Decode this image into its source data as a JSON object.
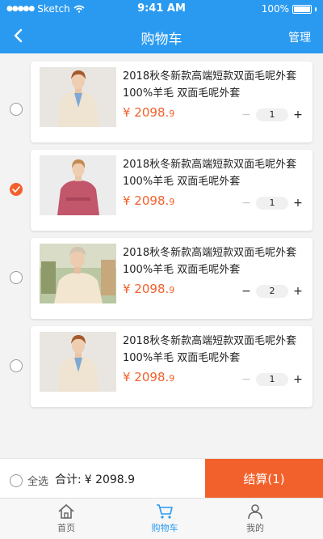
{
  "status": {
    "carrier": "Sketch",
    "time": "9:41 AM",
    "battery": "100%"
  },
  "nav": {
    "title": "购物车",
    "manage": "管理"
  },
  "items": [
    {
      "title": "2018秋冬新款高端短款双面毛呢外套100%羊毛 双面毛呢外套",
      "price_main": "¥ 2098.",
      "price_dec": "9",
      "qty": "1",
      "checked": false
    },
    {
      "title": "2018秋冬新款高端短款双面毛呢外套100%羊毛 双面毛呢外套",
      "price_main": "¥ 2098.",
      "price_dec": "9",
      "qty": "1",
      "checked": true
    },
    {
      "title": "2018秋冬新款高端短款双面毛呢外套100%羊毛 双面毛呢外套",
      "price_main": "¥ 2098.",
      "price_dec": "9",
      "qty": "2",
      "checked": false
    },
    {
      "title": "2018秋冬新款高端短款双面毛呢外套100%羊毛 双面毛呢外套",
      "price_main": "¥ 2098.",
      "price_dec": "9",
      "qty": "1",
      "checked": false
    }
  ],
  "footer": {
    "select_all": "全选",
    "total_label": "合计:",
    "total_value": "¥ 2098.9",
    "checkout": "结算(1)"
  },
  "tabs": [
    {
      "label": "首页",
      "icon": "home-icon"
    },
    {
      "label": "购物车",
      "icon": "cart-icon"
    },
    {
      "label": "我的",
      "icon": "user-icon"
    }
  ],
  "colors": {
    "primary": "#2a9af1",
    "accent": "#f2612c"
  }
}
